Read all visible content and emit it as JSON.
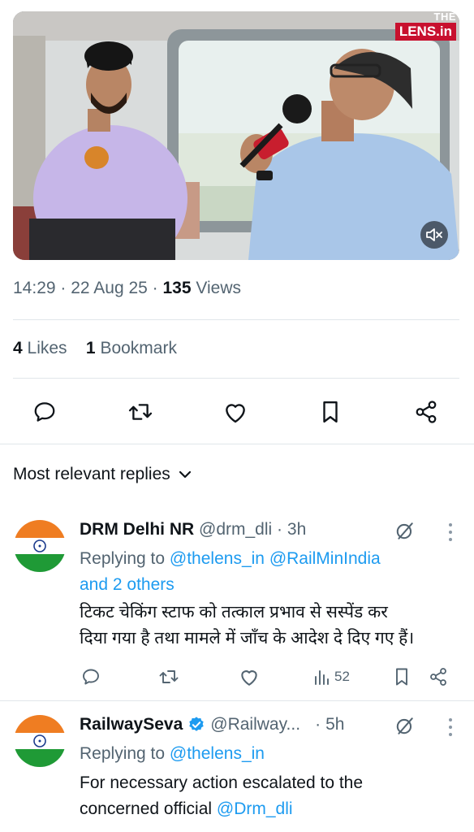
{
  "video": {
    "watermark_top": "THE",
    "watermark_brand": "LENS.in",
    "mic_label": "LENS",
    "mute_icon": "volume-mute-icon"
  },
  "tweet_meta": {
    "time": "14:29",
    "date": "22 Aug 25",
    "views_count": "135",
    "views_label": "Views"
  },
  "engagement": {
    "likes_count": "4",
    "likes_label": "Likes",
    "bookmarks_count": "1",
    "bookmarks_label": "Bookmark"
  },
  "actions": [
    "reply-icon",
    "retweet-icon",
    "like-icon",
    "bookmark-icon",
    "share-icon"
  ],
  "sort": {
    "label": "Most relevant replies"
  },
  "replies": [
    {
      "name": "DRM Delhi NR",
      "handle": "@drm_dli",
      "time_sep": "·",
      "time": "3h",
      "replying_prefix": "Replying to",
      "replying_to_1": "@thelens_in",
      "replying_to_2": "@RailMinIndia",
      "replying_more": "and 2 others",
      "text_line1": "टिकट चेकिंग स्टाफ को तत्काल प्रभाव से सस्पेंड कर",
      "text_line2": "दिया गया है तथा मामले में जाँच के आदेश दे दिए गए हैं।",
      "views": "52"
    },
    {
      "name": "RailwaySeva",
      "handle": "@Railway...",
      "time_sep": "·",
      "time": "5h",
      "replying_prefix": "Replying to",
      "replying_to_1": "@thelens_in",
      "text_line1": "For necessary action escalated to the",
      "text_line2": "concerned official",
      "mention": "@Drm_dli"
    }
  ],
  "colors": {
    "accent": "#1d9bf0",
    "secondary_text": "#536471",
    "divider": "#e1e6ea",
    "brand_red": "#c8102e",
    "verified_badge": "#1d9bf0"
  }
}
